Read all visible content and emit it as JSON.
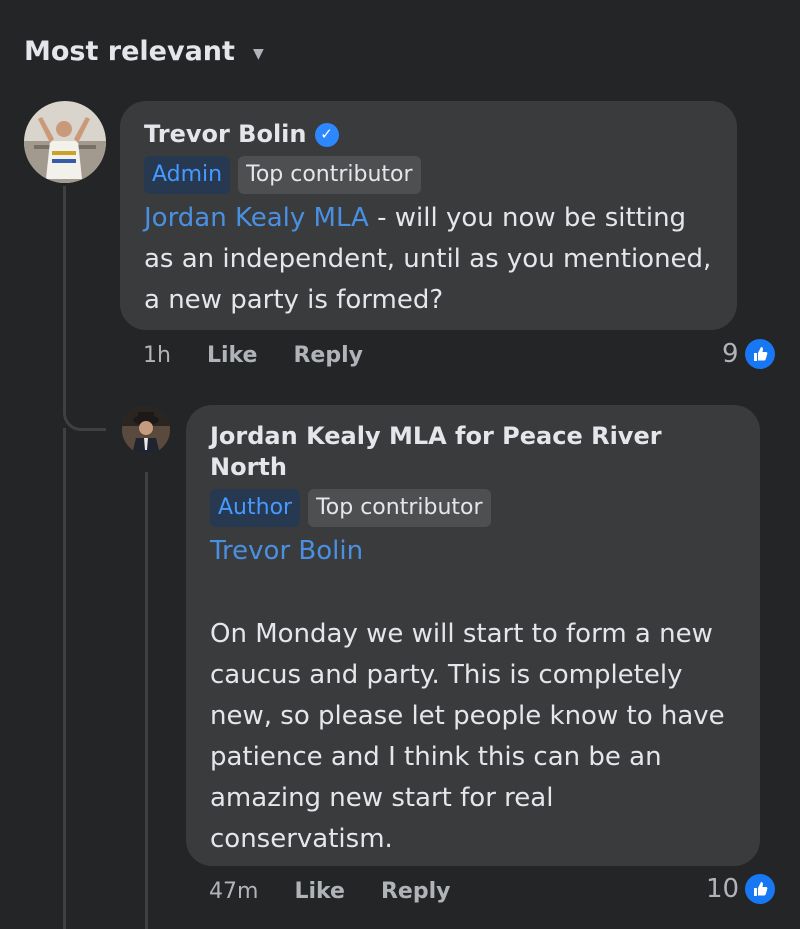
{
  "sort": {
    "label": "Most relevant",
    "chevron_icon": "chevron-down-icon"
  },
  "comment": {
    "author": "Trevor Bolin",
    "badges": [
      "Admin",
      "Top contributor"
    ],
    "mention": "Jordan Kealy MLA",
    "text": " - will you now be sitting as an independent, until as you mentioned, a new party is formed?",
    "time": "1h",
    "like_label": "Like",
    "reply_label": "Reply",
    "reaction_count": "9"
  },
  "reply": {
    "author": "Jordan Kealy MLA for Peace River North",
    "badges": [
      "Author",
      "Top contributor"
    ],
    "mention": "Trevor Bolin",
    "text": "On Monday we will start to form a new caucus and party.  This is completely new, so please let people know to have patience and I think this can be an amazing new start for real conservatism.",
    "time": "47m",
    "like_label": "Like",
    "reply_label": "Reply",
    "reaction_count": "10"
  },
  "colors": {
    "background": "#242526",
    "bubble": "#3a3b3c",
    "link": "#4a90e2",
    "like_blue": "#1877f2"
  }
}
